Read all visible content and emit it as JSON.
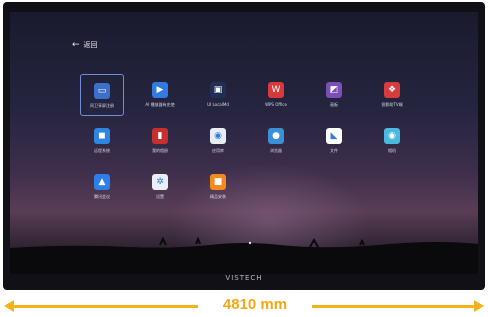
{
  "back": {
    "arrow": "←",
    "label": "返回"
  },
  "apps": [
    {
      "label": "同卫享屏注册",
      "icon": "cast-icon",
      "glyph": "▭",
      "color": "#3b6fc9",
      "selected": true
    },
    {
      "label": "AI 播放器有史使",
      "icon": "play-icon",
      "glyph": "▶",
      "color": "#2f7be0",
      "selected": false
    },
    {
      "label": "UI LocalMd",
      "icon": "file-icon",
      "glyph": "▣",
      "color": "#1f2f55",
      "selected": false
    },
    {
      "label": "WPS Office",
      "icon": "wps-icon",
      "glyph": "W",
      "color": "#d8393a",
      "selected": false
    },
    {
      "label": "画板",
      "icon": "whiteboard-icon",
      "glyph": "◩",
      "color": "#7b4fb5",
      "selected": false
    },
    {
      "label": "投影助TV端",
      "icon": "mirror-icon",
      "glyph": "❖",
      "color": "#d73c3c",
      "selected": false
    },
    {
      "label": "远程系统",
      "icon": "meeting-icon",
      "glyph": "◼",
      "color": "#2f86e0",
      "selected": false
    },
    {
      "label": "我的相册",
      "icon": "album-icon",
      "glyph": "▮",
      "color": "#c83030",
      "selected": false
    },
    {
      "label": "应用库",
      "icon": "app-store-icon",
      "glyph": "◉",
      "color": "#e8ecf5",
      "selected": false
    },
    {
      "label": "浏览器",
      "icon": "browser-icon",
      "glyph": "●",
      "color": "#3a8fd6",
      "selected": false
    },
    {
      "label": "文件",
      "icon": "files-icon",
      "glyph": "◣",
      "color": "#ffffff",
      "selected": false
    },
    {
      "label": "相机",
      "icon": "camera-icon",
      "glyph": "◉",
      "color": "#4bb8e0",
      "selected": false
    },
    {
      "label": "腾讯会议",
      "icon": "video-meeting-icon",
      "glyph": "▲",
      "color": "#2c7fe6",
      "selected": false
    },
    {
      "label": "设置",
      "icon": "gear-icon",
      "glyph": "✲",
      "color": "#e9eef8",
      "selected": false
    },
    {
      "label": "精品安装",
      "icon": "package-icon",
      "glyph": "■",
      "color": "#f28a1d",
      "selected": false
    }
  ],
  "brand": "VISTECH",
  "dimension": {
    "label": "4810 mm"
  },
  "colors": {
    "accent": "#f3b21a",
    "selection": "#6e8fd8"
  }
}
